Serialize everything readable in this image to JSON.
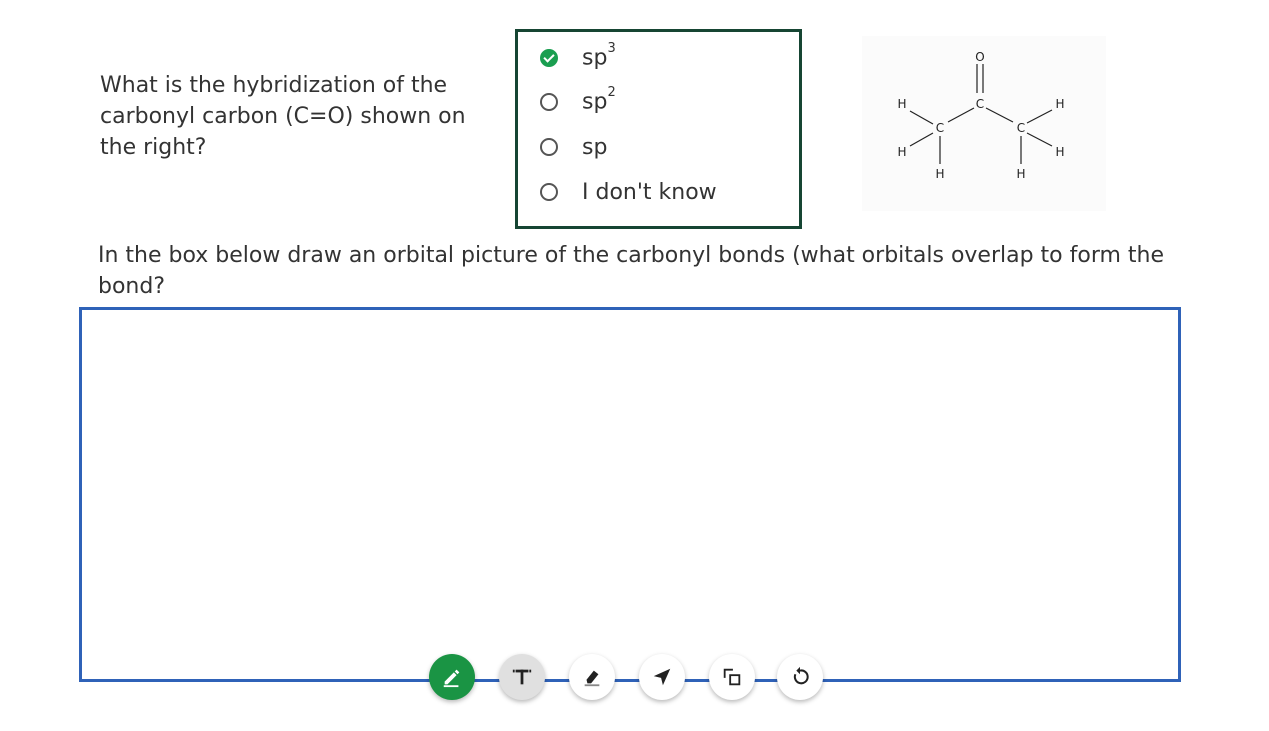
{
  "question": {
    "text": "What is the hybridization of the carbonyl carbon (C=O) shown on the right?"
  },
  "choices": [
    {
      "base": "sp",
      "sup": "3",
      "selected": true
    },
    {
      "base": "sp",
      "sup": "2",
      "selected": false
    },
    {
      "base": "sp",
      "sup": "",
      "selected": false
    },
    {
      "base": "I don't know",
      "sup": "",
      "selected": false
    }
  ],
  "molecule": {
    "atoms": [
      "O",
      "C",
      "C",
      "C",
      "H",
      "H",
      "H",
      "H",
      "H",
      "H"
    ]
  },
  "instruction": "In the box below draw an orbital picture of the carbonyl bonds (what orbitals overlap to form the bond?",
  "toolbar": {
    "tools": [
      "pen-icon",
      "text-icon",
      "eraser-icon",
      "pointer-icon",
      "shapes-icon",
      "undo-icon"
    ],
    "active_tool": "pen-icon"
  },
  "colors": {
    "accent_green": "#1a9444",
    "choice_border": "#164533",
    "canvas_border": "#2f62b8",
    "text": "#333333"
  }
}
